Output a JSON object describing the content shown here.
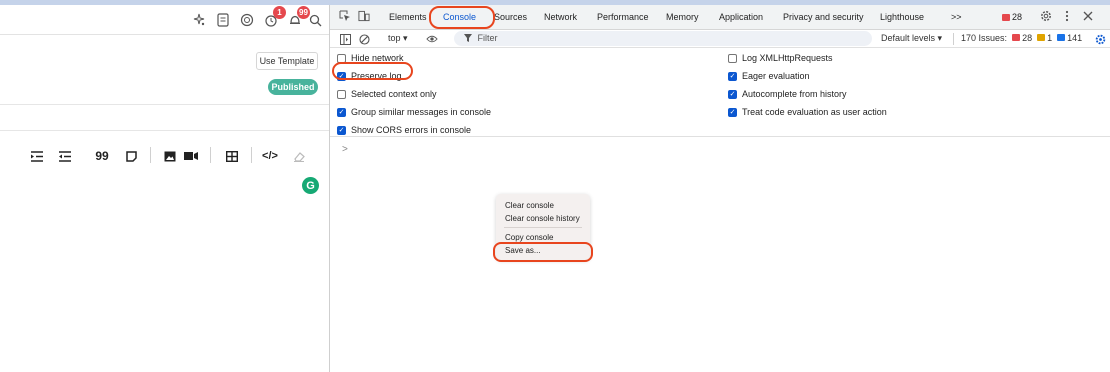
{
  "editor": {
    "use_template_label": "Use Template",
    "published_label": "Published",
    "notification_badge": "1",
    "inbox_badge": "99",
    "toolbar_icons": [
      "sparkle-icon",
      "document-icon",
      "extension-icon",
      "notification-icon",
      "bell-icon",
      "search-icon"
    ],
    "format_icons": [
      "indent-icon",
      "outdent-icon",
      "quote-icon",
      "note-icon",
      "image-icon",
      "video-icon",
      "table-icon",
      "code-icon",
      "eraser-icon"
    ],
    "quote_glyph": "99",
    "code_glyph": "</>",
    "grammarly_letter": "G"
  },
  "devtools": {
    "tabs": [
      "Elements",
      "Console",
      "Sources",
      "Network",
      "Performance",
      "Memory",
      "Application",
      "Privacy and security",
      "Lighthouse"
    ],
    "more_tabs": ">>",
    "error_count": "28",
    "filter": {
      "context": "top ▾",
      "placeholder": "Filter",
      "levels": "Default levels ▾",
      "issues_label": "170 Issues:",
      "issues_errors": "28",
      "issues_warnings": "1",
      "issues_info": "141"
    },
    "settings_left": [
      {
        "label": "Hide network",
        "checked": false
      },
      {
        "label": "Preserve log",
        "checked": true
      },
      {
        "label": "Selected context only",
        "checked": false
      },
      {
        "label": "Group similar messages in console",
        "checked": true
      },
      {
        "label": "Show CORS errors in console",
        "checked": true
      }
    ],
    "settings_right": [
      {
        "label": "Log XMLHttpRequests",
        "checked": false
      },
      {
        "label": "Eager evaluation",
        "checked": true
      },
      {
        "label": "Autocomplete from history",
        "checked": true
      },
      {
        "label": "Treat code evaluation as user action",
        "checked": true
      }
    ],
    "prompt": ">",
    "context_menu": {
      "clear_console": "Clear console",
      "clear_history": "Clear console history",
      "copy_console": "Copy console",
      "save_as": "Save as..."
    },
    "colors": {
      "highlight": "#e8451e",
      "accent": "#0b57d0",
      "error": "#e5484d"
    }
  }
}
